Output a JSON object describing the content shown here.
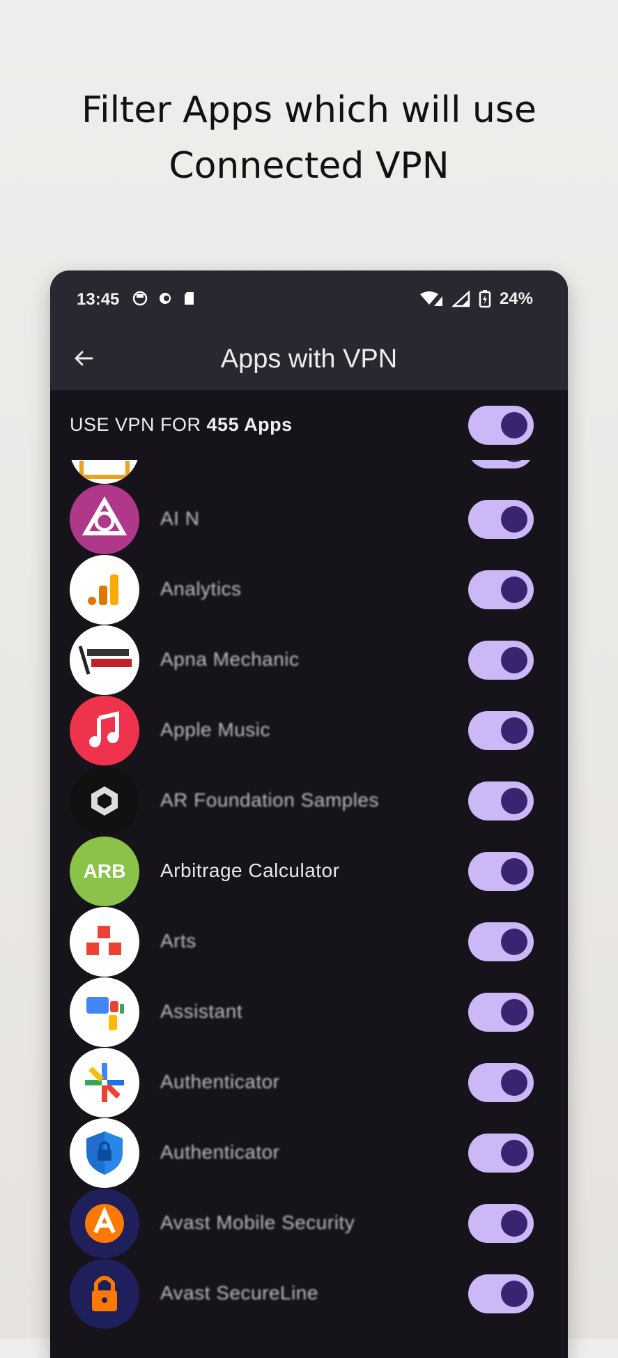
{
  "promo": {
    "line1": "Filter Apps which will use",
    "line2": "Connected VPN"
  },
  "status_bar": {
    "time": "13:45",
    "battery": "24%"
  },
  "app_bar": {
    "title": "Apps with VPN"
  },
  "master": {
    "prefix": "USE VPN FOR ",
    "count": "455 Apps",
    "enabled": true
  },
  "apps": [
    {
      "name": "",
      "icon": "app-icon-partial",
      "color": "#ffffff",
      "enabled": true
    },
    {
      "name": "AI N",
      "icon": "ai-app-icon",
      "color": "#b0388a",
      "enabled": true
    },
    {
      "name": "Analytics",
      "icon": "analytics-icon",
      "color": "#ffffff",
      "enabled": true
    },
    {
      "name": "Apna Mechanic",
      "icon": "apna-mechanic-icon",
      "color": "#ffffff",
      "enabled": true
    },
    {
      "name": "Apple Music",
      "icon": "music-note-icon",
      "color": "#f0334d",
      "enabled": true
    },
    {
      "name": "AR Foundation Samples",
      "icon": "ar-icon",
      "color": "#111111",
      "enabled": true
    },
    {
      "name": "Arbitrage Calculator",
      "icon": "arb-icon",
      "color": "#8bc34a",
      "badge": "ARB",
      "enabled": true
    },
    {
      "name": "Arts",
      "icon": "arts-icon",
      "color": "#ffffff",
      "enabled": true
    },
    {
      "name": "Assistant",
      "icon": "assistant-icon",
      "color": "#ffffff",
      "enabled": true
    },
    {
      "name": "Authenticator",
      "icon": "authenticator-icon",
      "color": "#ffffff",
      "enabled": true
    },
    {
      "name": "Authenticator",
      "icon": "shield-lock-icon",
      "color": "#ffffff",
      "enabled": true
    },
    {
      "name": "Avast Mobile Security",
      "icon": "avast-icon",
      "color": "#1f1f5c",
      "enabled": true
    },
    {
      "name": "Avast SecureLine",
      "icon": "secureline-lock-icon",
      "color": "#1f1f5c",
      "enabled": true
    }
  ]
}
